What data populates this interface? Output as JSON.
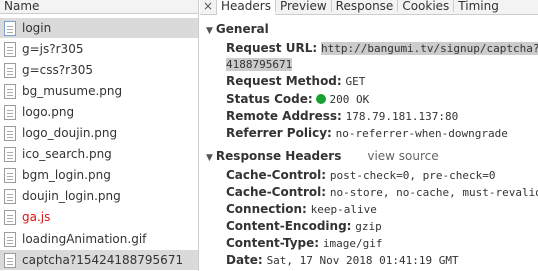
{
  "left": {
    "header": "Name",
    "files": [
      {
        "name": "login",
        "type": "doc",
        "selected": true,
        "red": false
      },
      {
        "name": "g=js?r305",
        "type": "file",
        "selected": false,
        "red": false
      },
      {
        "name": "g=css?r305",
        "type": "file",
        "selected": false,
        "red": false
      },
      {
        "name": "bg_musume.png",
        "type": "file",
        "selected": false,
        "red": false
      },
      {
        "name": "logo.png",
        "type": "file",
        "selected": false,
        "red": false
      },
      {
        "name": "logo_doujin.png",
        "type": "file",
        "selected": false,
        "red": false
      },
      {
        "name": "ico_search.png",
        "type": "file",
        "selected": false,
        "red": false
      },
      {
        "name": "bgm_login.png",
        "type": "file",
        "selected": false,
        "red": false
      },
      {
        "name": "doujin_login.png",
        "type": "file",
        "selected": false,
        "red": false
      },
      {
        "name": "ga.js",
        "type": "file",
        "selected": false,
        "red": true
      },
      {
        "name": "loadingAnimation.gif",
        "type": "file",
        "selected": false,
        "red": false
      },
      {
        "name": "captcha?15424188795671",
        "type": "file",
        "selected": true,
        "red": false
      }
    ]
  },
  "tabs": {
    "close": "×",
    "headers": "Headers",
    "preview": "Preview",
    "response": "Response",
    "cookies": "Cookies",
    "timing": "Timing"
  },
  "general": {
    "title": "General",
    "request_url_key": "Request URL:",
    "request_url_val": "http://bangumi.tv/signup/captcha?",
    "request_url_val2": "4188795671",
    "method_key": "Request Method:",
    "method_val": "GET",
    "status_key": "Status Code:",
    "status_val": "200 OK",
    "remote_key": "Remote Address:",
    "remote_val": "178.79.181.137:80",
    "referrer_key": "Referrer Policy:",
    "referrer_val": "no-referrer-when-downgrade"
  },
  "response_headers": {
    "title": "Response Headers",
    "view_source": "view source",
    "items": [
      {
        "key": "Cache-Control:",
        "val": "post-check=0, pre-check=0"
      },
      {
        "key": "Cache-Control:",
        "val": "no-store, no-cache, must-revalid"
      },
      {
        "key": "Connection:",
        "val": "keep-alive"
      },
      {
        "key": "Content-Encoding:",
        "val": "gzip"
      },
      {
        "key": "Content-Type:",
        "val": "image/gif"
      },
      {
        "key": "Date:",
        "val": "Sat, 17 Nov 2018 01:41:19 GMT"
      }
    ]
  },
  "colors": {
    "status_ok": "#19a233",
    "error_text": "#dd1111"
  }
}
